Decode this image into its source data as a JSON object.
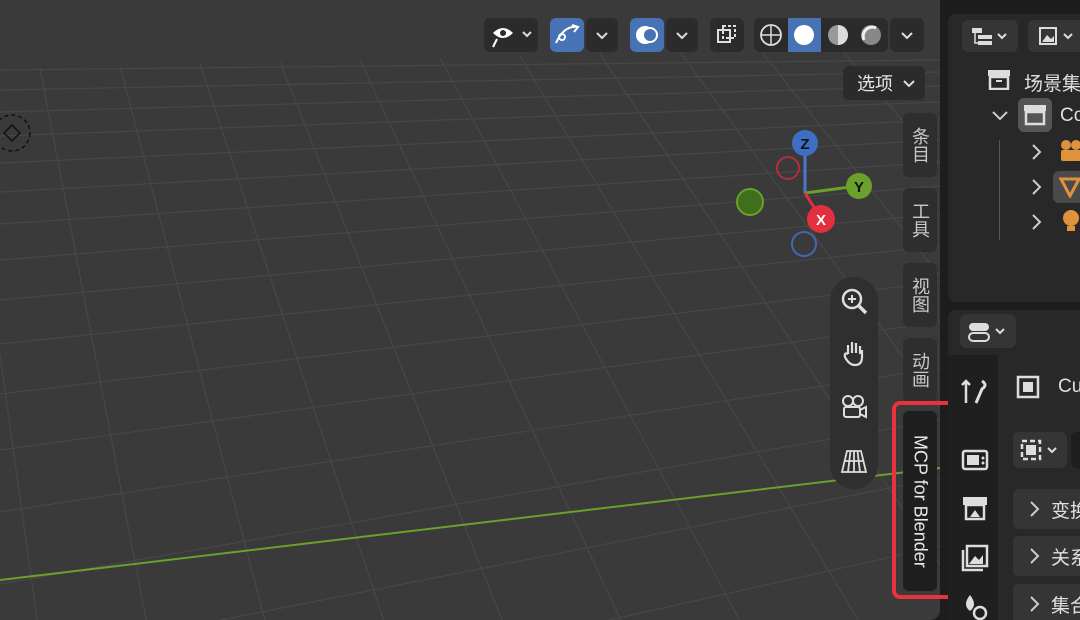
{
  "viewport": {
    "options_label": "选项",
    "axis_labels": {
      "z": "Z",
      "y": "Y",
      "x": "X"
    },
    "side_tabs": [
      "条目",
      "工具",
      "视图",
      "动画"
    ],
    "addon_tab": "MCP for Blender"
  },
  "outliner": {
    "scene_collection_label": "场景集",
    "collection_label": "Co"
  },
  "properties": {
    "object_label": "Cu",
    "panels": [
      "变换",
      "关系",
      "集合"
    ]
  }
}
